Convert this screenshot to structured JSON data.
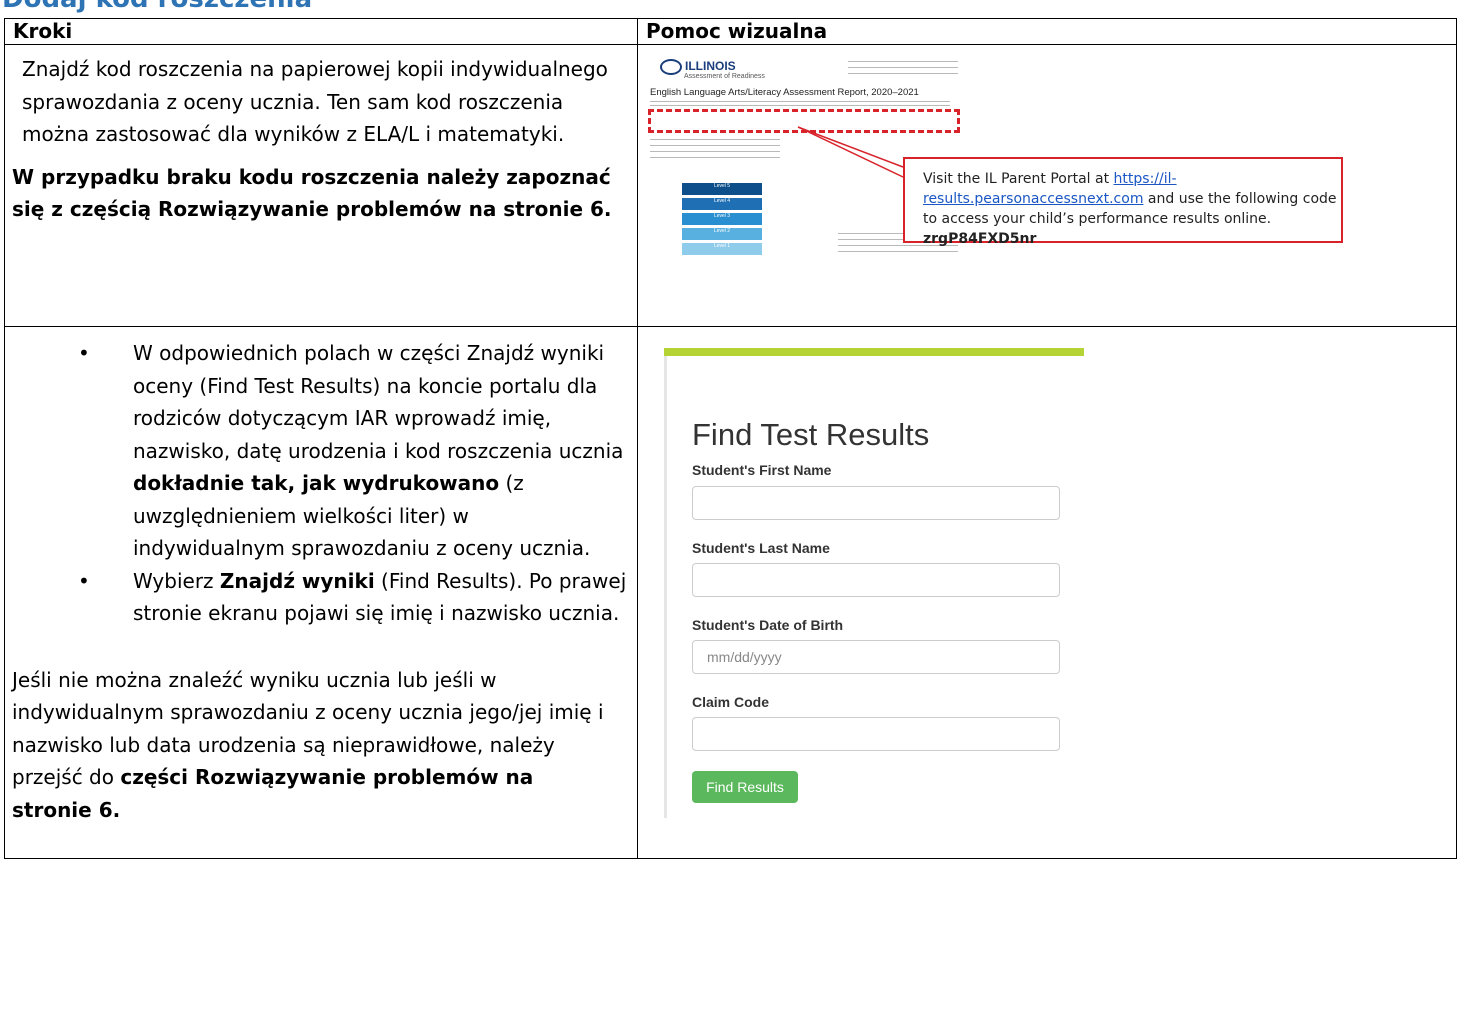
{
  "heading": "Dodaj kod roszczenia",
  "table": {
    "col_steps": "Kroki",
    "col_visual": "Pomoc wizualna"
  },
  "row1": {
    "text": "Znajdź kod roszczenia na papierowej kopii indywidualnego sprawozdania z oceny ucznia. Ten sam kod roszczenia można zastosować dla wyników z ELA/L i matematyki.",
    "bold_text": "W przypadku braku kodu roszczenia należy zapoznać się z częścią Rozwiązywanie problemów na stronie 6."
  },
  "report": {
    "logo": "ILLINOIS",
    "logo_sub": "Assessment of Readiness",
    "title": "English Language Arts/Literacy Assessment Report, 2020–2021",
    "levels": [
      "Level 5",
      "Level 4",
      "Level 3",
      "Level 2",
      "Level 1"
    ],
    "callout_prefix": "Visit the IL Parent Portal at ",
    "callout_link": "https://il-results.pearsonaccessnext.com",
    "callout_mid": " and use the following code to access your child’s performance results online.",
    "callout_code": "zrgP84FXD5nr"
  },
  "row2": {
    "bullet1_a": "W odpowiednich polach w części Znajdź wyniki oceny (Find Test Results) na koncie portalu dla rodziców dotyczącym IAR wprowadź imię, nazwisko, datę urodzenia i kod roszczenia ucznia ",
    "bullet1_b": "dokładnie tak, jak wydrukowano",
    "bullet1_c": " (z uwzględnieniem wielkości liter) w indywidualnym sprawozdaniu z oceny ucznia.",
    "bullet2_a": "Wybierz ",
    "bullet2_b": "Znajdź wyniki",
    "bullet2_c": " (Find Results). Po prawej stronie ekranu pojawi się imię i nazwisko ucznia.",
    "para_a": "Jeśli nie można znaleźć wyniku ucznia lub jeśli w indywidualnym sprawozdaniu z oceny ucznia jego/jej imię i nazwisko lub data urodzenia są nieprawidłowe, należy przejść do ",
    "para_b": "części Rozwiązywanie problemów na stronie 6."
  },
  "form": {
    "title": "Find Test Results",
    "first_name_label": "Student's First Name",
    "last_name_label": "Student's Last Name",
    "dob_label": "Student's Date of Birth",
    "dob_placeholder": "mm/dd/yyyy",
    "claim_label": "Claim Code",
    "button": "Find Results",
    "accent_color": "#b5d334",
    "button_color": "#5cb85c"
  }
}
